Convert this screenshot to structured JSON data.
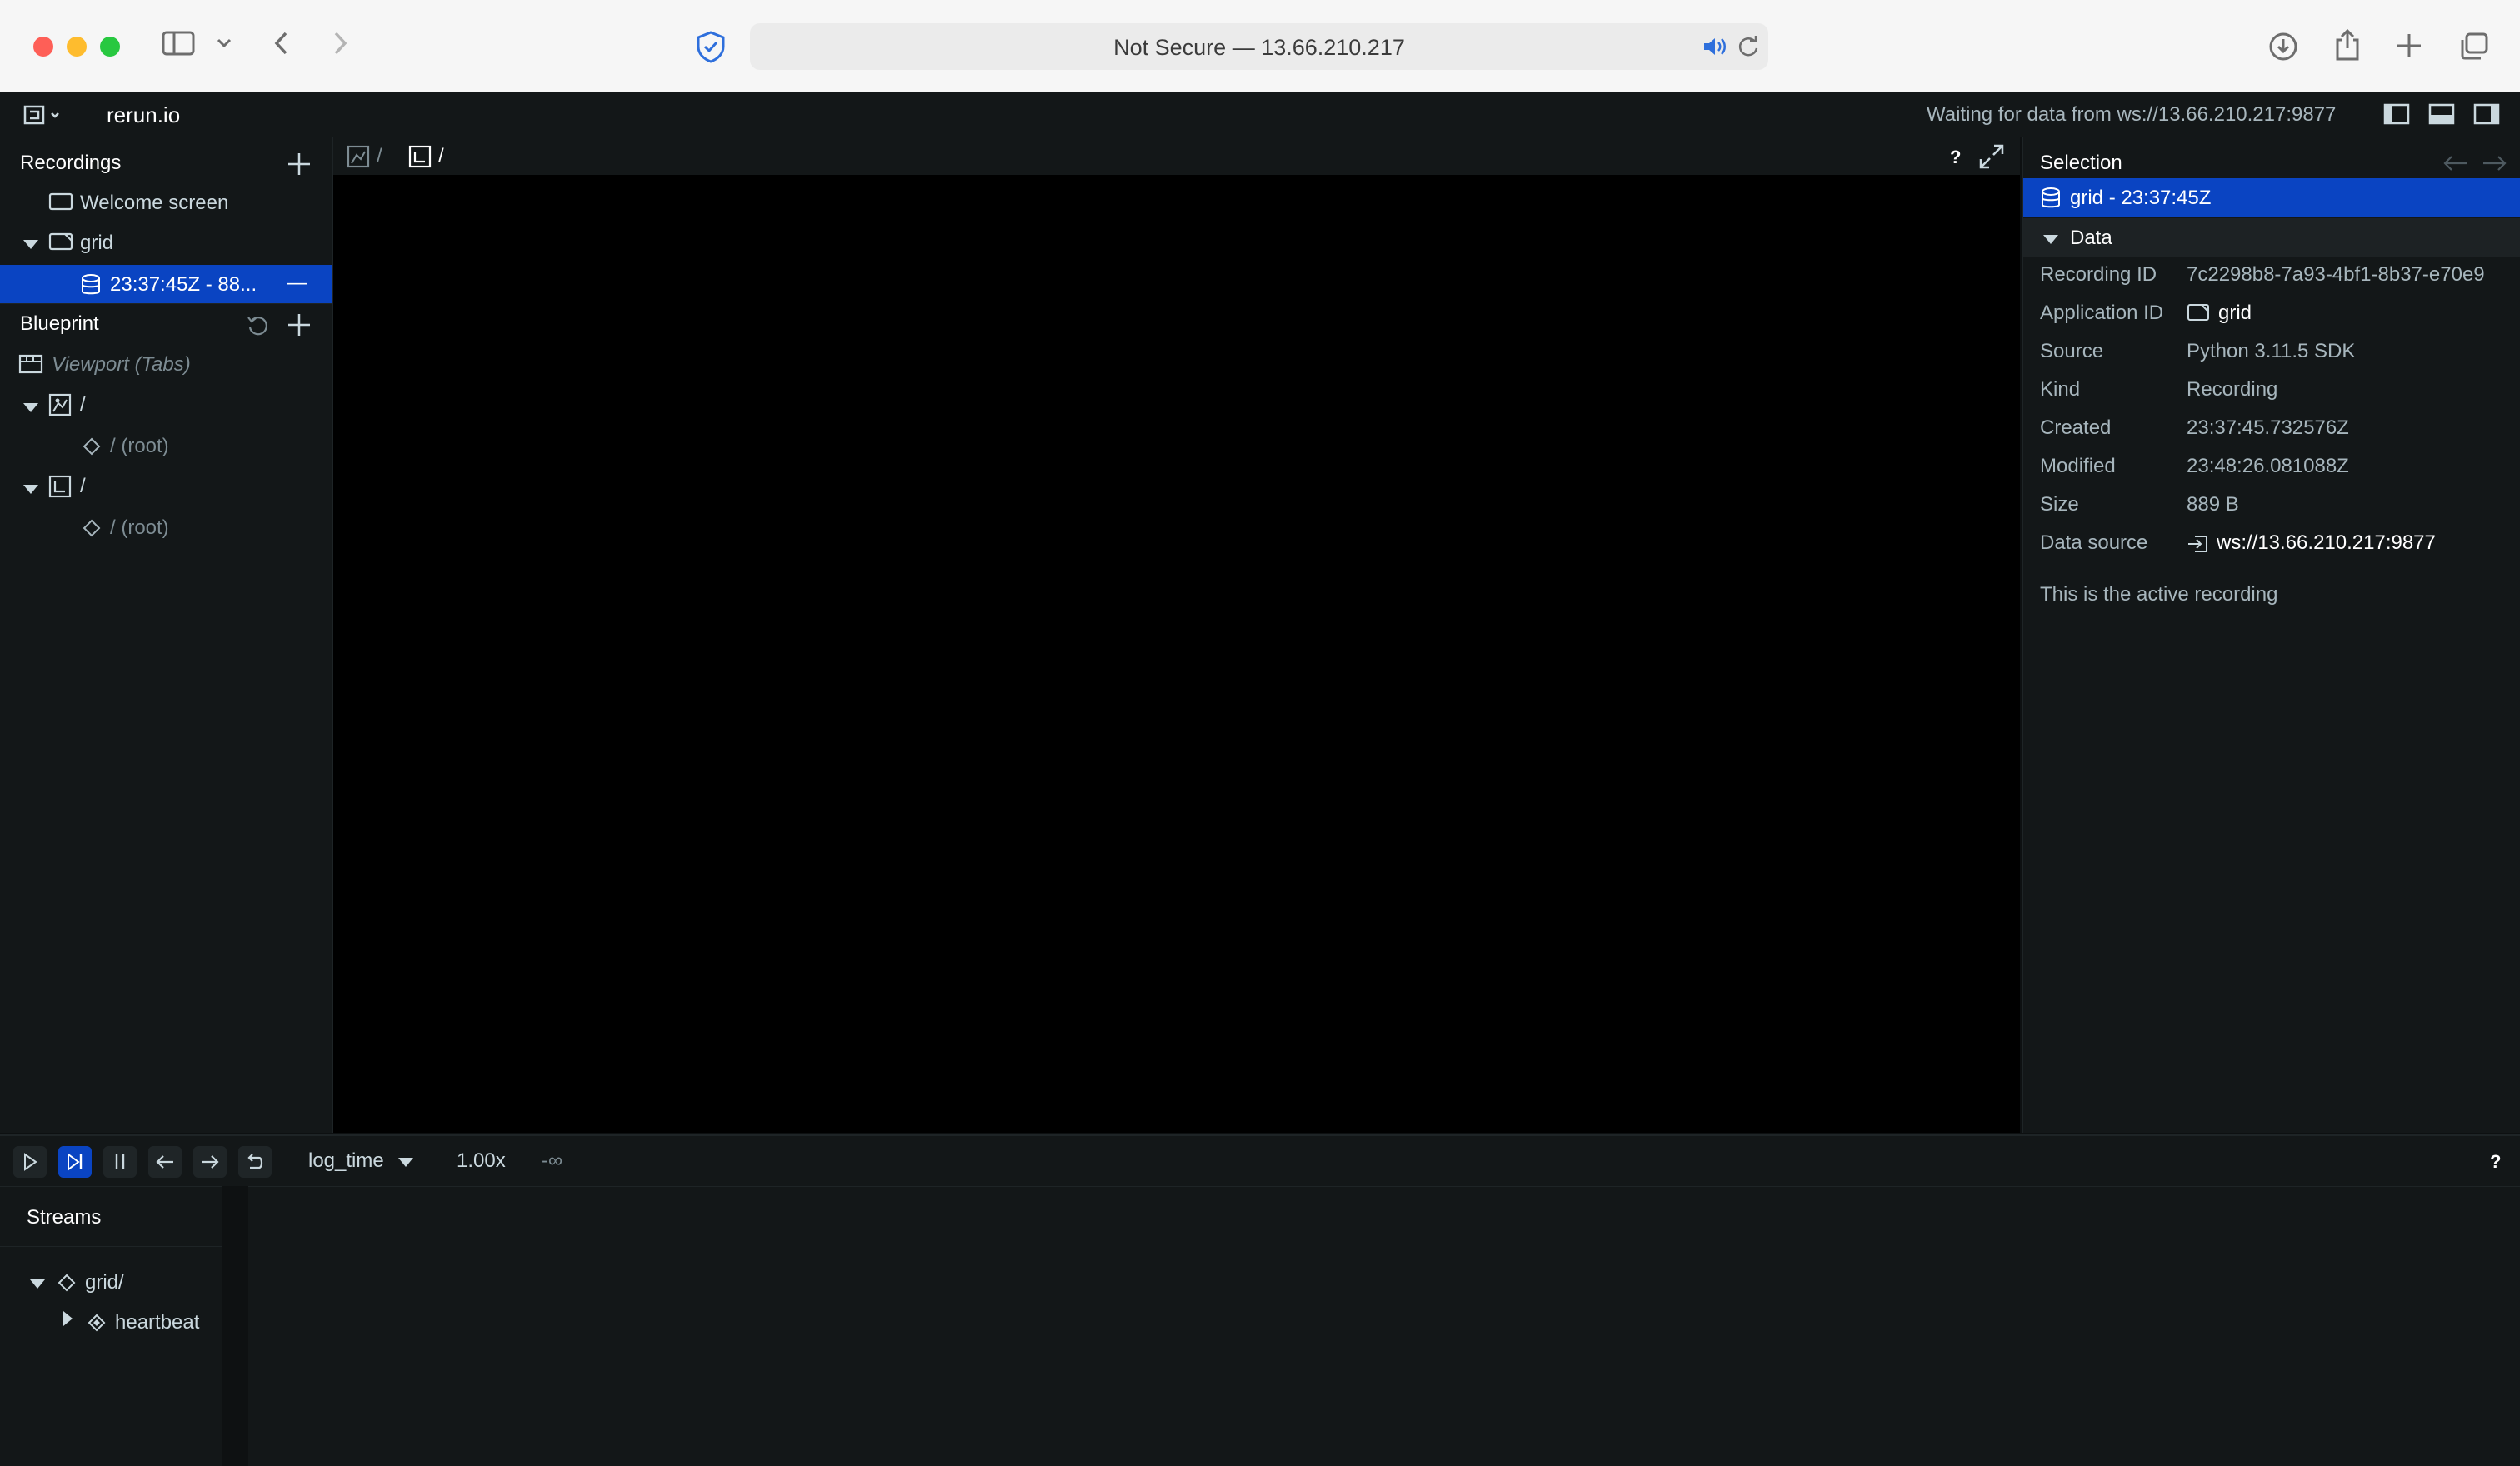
{
  "browser": {
    "url_text": "Not Secure — 13.66.210.217"
  },
  "app": {
    "logo_label": "rerun.io",
    "status": "Waiting for data from ws://13.66.210.217:9877"
  },
  "recordings": {
    "title": "Recordings",
    "items": [
      {
        "label": "Welcome screen"
      },
      {
        "label": "grid"
      },
      {
        "label": "23:37:45Z - 88...",
        "close": "—"
      }
    ]
  },
  "blueprint": {
    "title": "Blueprint",
    "viewport_label": "Viewport (Tabs)",
    "views": [
      {
        "label": "/",
        "child": "/ (root)"
      },
      {
        "label": "/",
        "child": "/ (root)"
      }
    ]
  },
  "view_tabs": {
    "tab1": "/",
    "tab2": "/",
    "help": "?"
  },
  "selection": {
    "title": "Selection",
    "item": "grid - 23:37:45Z",
    "section": "Data",
    "rows": [
      {
        "key": "Recording ID",
        "value": "7c2298b8-7a93-4bf1-8b37-e70e9"
      },
      {
        "key": "Application ID",
        "value": "grid"
      },
      {
        "key": "Source",
        "value": "Python 3.11.5 SDK"
      },
      {
        "key": "Kind",
        "value": "Recording"
      },
      {
        "key": "Created",
        "value": "23:37:45.732576Z"
      },
      {
        "key": "Modified",
        "value": "23:48:26.081088Z"
      },
      {
        "key": "Size",
        "value": "889 B"
      },
      {
        "key": "Data source",
        "value": "ws://13.66.210.217:9877"
      }
    ],
    "note": "This is the active recording"
  },
  "timeline": {
    "timeline_name": "log_time",
    "speed": "1.00x",
    "time_value": "-∞",
    "help": "?"
  },
  "streams": {
    "title": "Streams",
    "root": "grid/",
    "child": "heartbeat"
  }
}
